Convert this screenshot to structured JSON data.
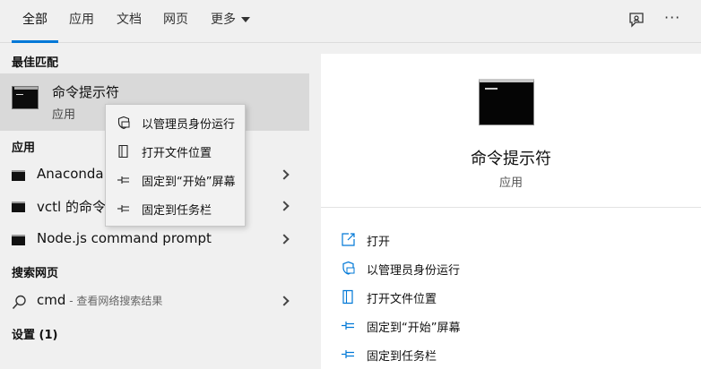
{
  "tabs": [
    {
      "label": "全部",
      "active": true
    },
    {
      "label": "应用"
    },
    {
      "label": "文档"
    },
    {
      "label": "网页"
    },
    {
      "label": "更多"
    }
  ],
  "top_icons": [
    "feedback-icon",
    "more-options-icon"
  ],
  "more_icon_text": "···",
  "left": {
    "best_match_header": "最佳匹配",
    "best_match": {
      "title": "命令提示符",
      "subtitle": "应用"
    },
    "apps_header": "应用",
    "apps": [
      {
        "label": "Anaconda"
      },
      {
        "label": "vctl 的命令"
      },
      {
        "label": "Node.js command prompt"
      }
    ],
    "web_header": "搜索网页",
    "web_result": {
      "query": "cmd",
      "hint": " - 查看网络搜索结果"
    },
    "settings_header": "设置 (1)"
  },
  "context_menu": [
    {
      "label": "以管理员身份运行",
      "icon": "shield-icon"
    },
    {
      "label": "打开文件位置",
      "icon": "file-location-icon"
    },
    {
      "label": "固定到“开始”屏幕",
      "icon": "pin-icon"
    },
    {
      "label": "固定到任务栏",
      "icon": "pin-icon"
    }
  ],
  "preview": {
    "title": "命令提示符",
    "subtitle": "应用",
    "actions": [
      {
        "label": "打开",
        "icon": "open-icon"
      },
      {
        "label": "以管理员身份运行",
        "icon": "shield-icon"
      },
      {
        "label": "打开文件位置",
        "icon": "file-location-icon"
      },
      {
        "label": "固定到“开始”屏幕",
        "icon": "pin-icon"
      },
      {
        "label": "固定到任务栏",
        "icon": "pin-icon"
      }
    ]
  },
  "colors": {
    "accent": "#0078d7",
    "selected_row": "#d9d9d9",
    "panel": "#f0f0f0"
  }
}
